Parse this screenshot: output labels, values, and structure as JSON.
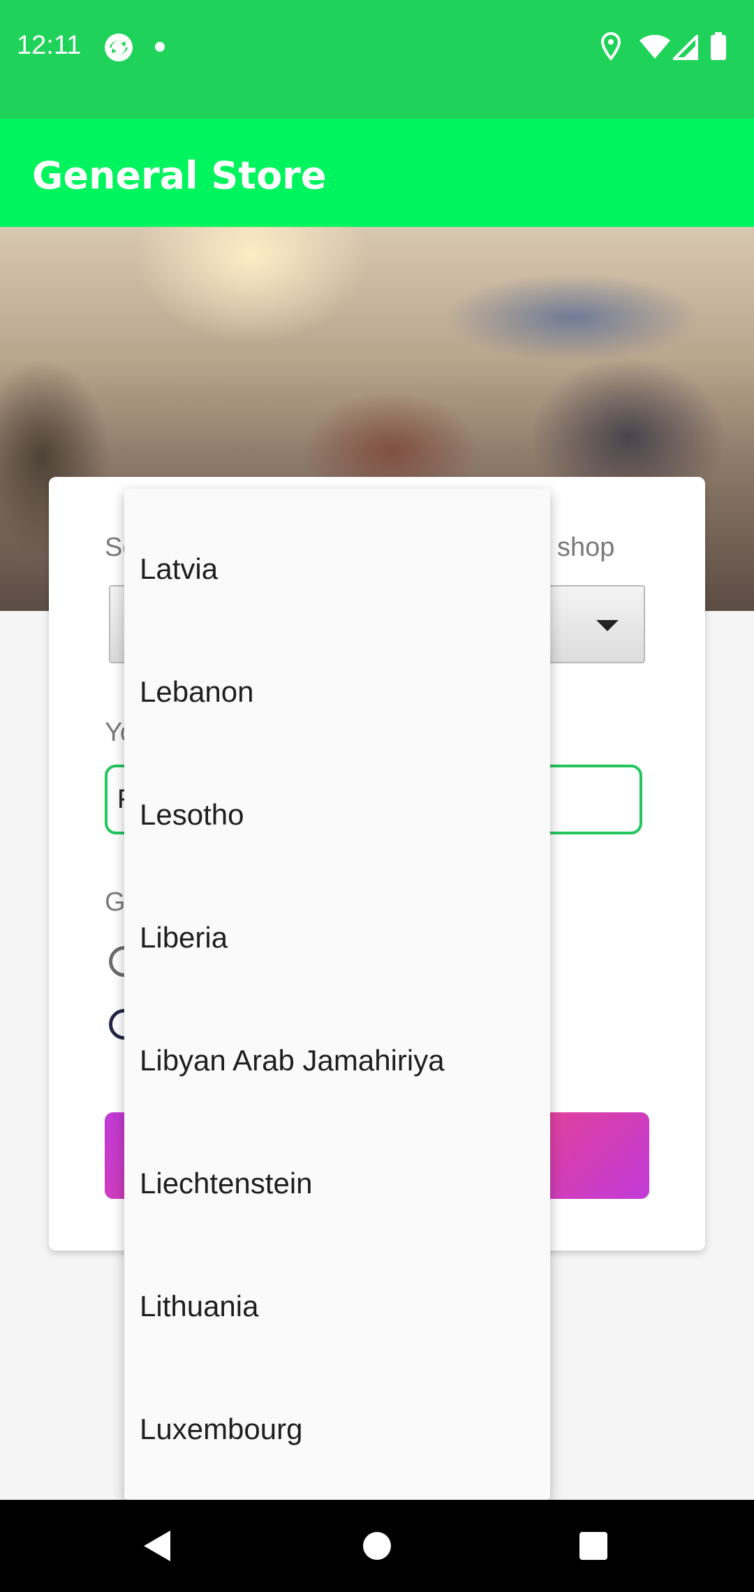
{
  "status_bar": {
    "time": "12:11",
    "icons": [
      "sync-icon",
      "notification-dot-icon",
      "location-icon",
      "wifi-icon",
      "cellular-icon",
      "battery-icon"
    ]
  },
  "app_bar": {
    "title": "General Store"
  },
  "form": {
    "country_label_left": "So",
    "country_label_right": "shop",
    "name_label": "Yo",
    "name_value": "F",
    "gender_label": "G"
  },
  "dropdown": {
    "items": [
      "Latvia",
      "Lebanon",
      "Lesotho",
      "Liberia",
      "Libyan Arab Jamahiriya",
      "Liechtenstein",
      "Lithuania",
      "Luxembourg"
    ]
  },
  "colors": {
    "status_bar": "#1fd25a",
    "app_bar": "#00f45d",
    "accent_green": "#22c55e",
    "button_gradient_start": "#c13ad8",
    "button_gradient_end": "#f0457e"
  },
  "nav_bar": {
    "icons": [
      "back-icon",
      "home-icon",
      "recents-icon"
    ]
  }
}
